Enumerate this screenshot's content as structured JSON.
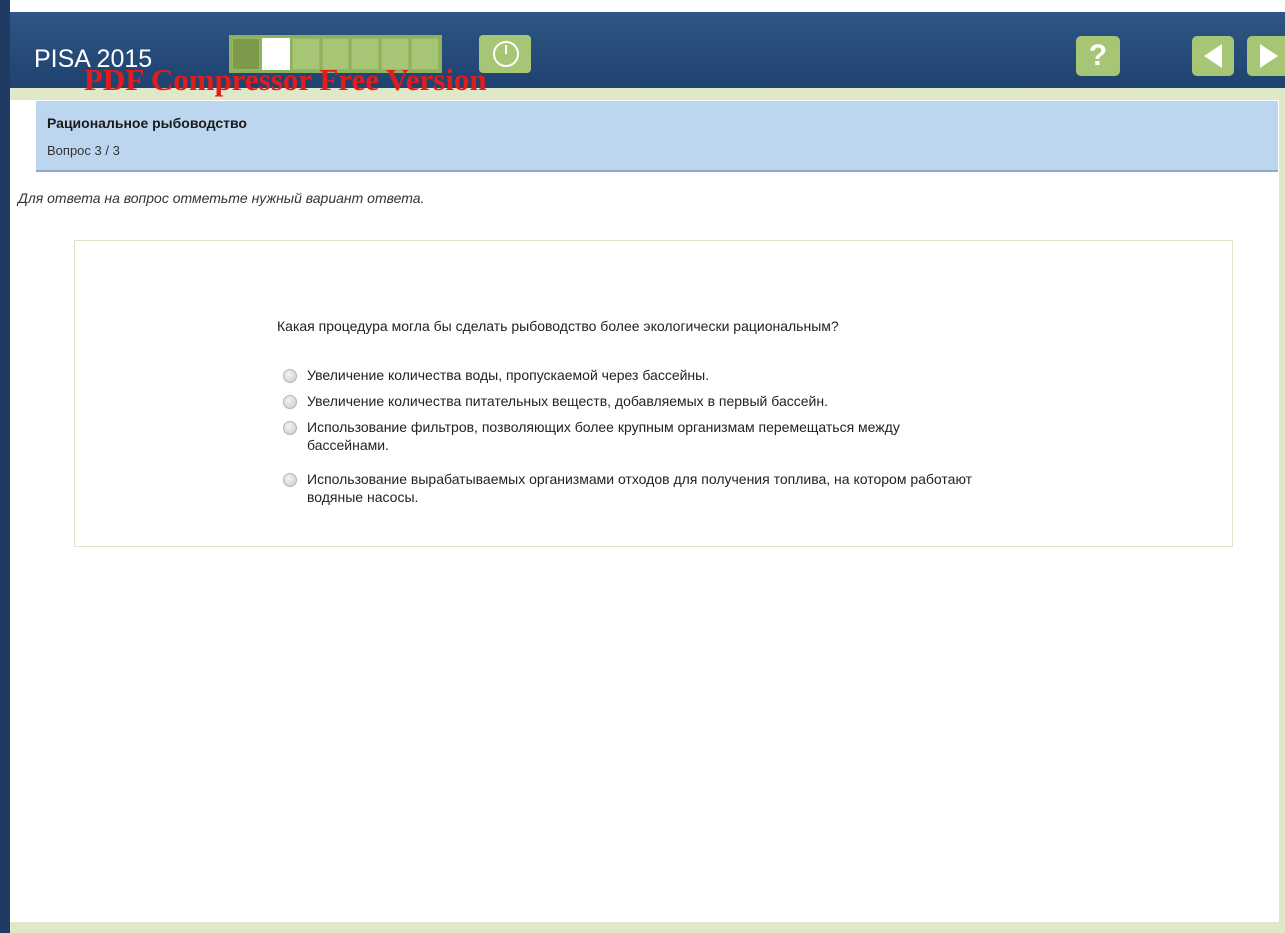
{
  "header": {
    "app_title": "PISA 2015",
    "progress": {
      "total_segments": 7,
      "completed": 1,
      "current": 2
    },
    "timer_icon": "clock-icon",
    "help_label": "?",
    "help_icon": "question-mark-icon",
    "prev_icon": "arrow-left-icon",
    "next_icon": "arrow-right-icon",
    "accent_color": "#a6c575",
    "bar_color": "#1e416e"
  },
  "watermark": "PDF Compressor Free Version",
  "unit": {
    "title": "Рациональное рыбоводство",
    "question_number": "Вопрос 3 / 3"
  },
  "instruction": "Для ответа на вопрос отметьте нужный вариант ответа.",
  "question": {
    "text": "Какая процедура могла бы сделать рыбоводство более экологически рациональным?",
    "options": [
      {
        "label": "Увеличение количества воды, пропускаемой через бассейны."
      },
      {
        "label": "Увеличение количества питательных веществ, добавляемых в первый бассейн."
      },
      {
        "label": "Использование фильтров, позволяющих более крупным организмам перемещаться между бассейнами."
      },
      {
        "label": "Использование вырабатываемых организмами отходов для получения топлива, на котором работают водяные насосы."
      }
    ]
  }
}
